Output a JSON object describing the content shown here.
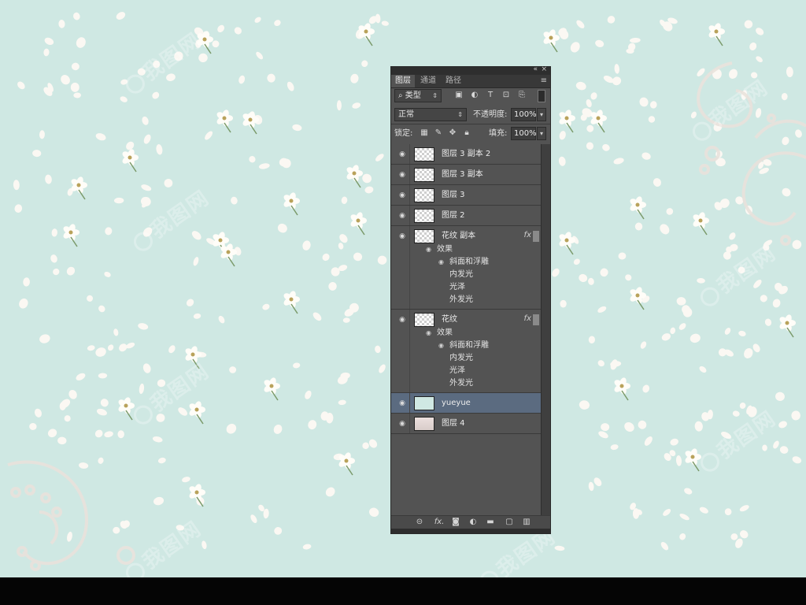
{
  "panel": {
    "tabs": [
      "图层",
      "通道",
      "路径"
    ],
    "collapse_icon": "«",
    "close_icon": "×",
    "menu_icon": "≡",
    "filter_label": "类型",
    "filter_icons": [
      "image-filter-icon",
      "adjustment-filter-icon",
      "text-filter-icon",
      "shape-filter-icon",
      "smart-object-filter-icon"
    ],
    "blend_mode": "正常",
    "opacity_label": "不透明度:",
    "opacity_value": "100%",
    "lock_label": "锁定:",
    "fill_label": "填充:",
    "fill_value": "100%"
  },
  "layers": [
    {
      "name": "图层 3 副本 2",
      "thumb": "transparent",
      "visible": true
    },
    {
      "name": "图层 3 副本",
      "thumb": "transparent",
      "visible": true
    },
    {
      "name": "图层 3",
      "thumb": "transparent",
      "visible": true
    },
    {
      "name": "图层 2",
      "thumb": "transparent",
      "visible": true
    },
    {
      "name": "花纹 副本",
      "thumb": "transparent",
      "visible": true,
      "fx": "fx",
      "effects_label": "效果",
      "effects": [
        "斜面和浮雕",
        "内发光",
        "光泽",
        "外发光"
      ]
    },
    {
      "name": "花纹",
      "thumb": "transparent",
      "visible": true,
      "fx": "fx",
      "effects_label": "效果",
      "effects": [
        "斜面和浮雕",
        "内发光",
        "光泽",
        "外发光"
      ]
    },
    {
      "name": "yueyue",
      "thumb": "teal",
      "visible": true,
      "selected": true
    },
    {
      "name": "图层 4",
      "thumb": "pink",
      "visible": true
    }
  ],
  "footer_icons": [
    "link-icon",
    "fx-icon",
    "mask-icon",
    "adjustment-icon",
    "folder-icon",
    "new-layer-icon",
    "trash-icon"
  ],
  "footer_fx_label": "fx.",
  "watermark": "我图网",
  "colors": {
    "background": "#cfe8e3",
    "panel": "#535353",
    "selected_layer": "#5b6b80"
  }
}
